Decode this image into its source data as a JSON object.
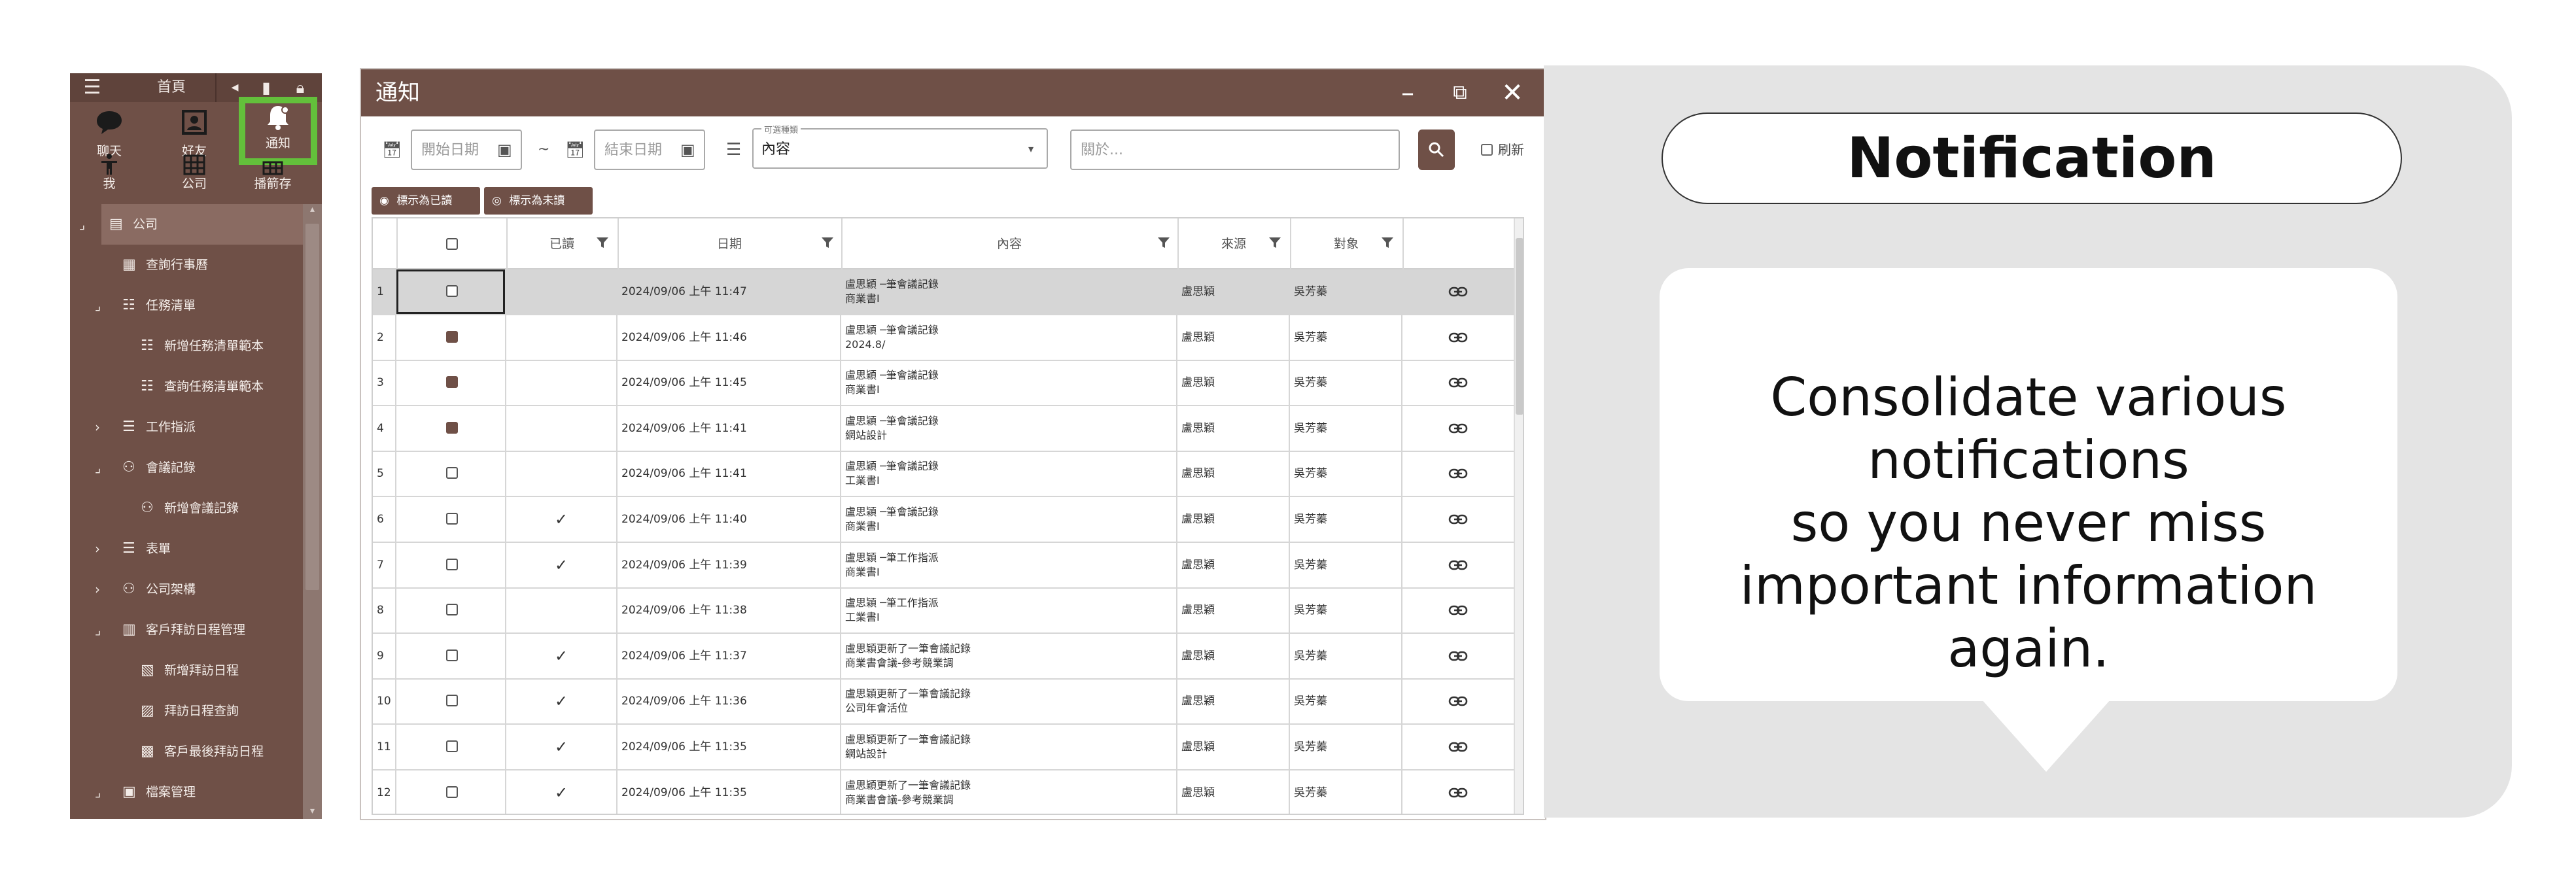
{
  "sidebar": {
    "title": "首頁",
    "tiles": [
      {
        "icon": "chat-bubble-icon",
        "label": "聊天"
      },
      {
        "icon": "friend-card-icon",
        "label": "好友"
      },
      {
        "icon": "bell-icon",
        "label": "通知"
      },
      {
        "icon": "person-icon",
        "label": "我"
      },
      {
        "icon": "building-icon",
        "label": "公司"
      },
      {
        "icon": "grid-icon",
        "label": "播箭存"
      }
    ],
    "tree": [
      {
        "label": "公司",
        "icon": "building-icon",
        "caret": "⌟",
        "indent": 0
      },
      {
        "label": "查詢行事曆",
        "icon": "calendar-icon",
        "caret": "",
        "indent": 1
      },
      {
        "label": "任務清單",
        "icon": "task-list-icon",
        "caret": "⌟",
        "indent": 1
      },
      {
        "label": "新增任務清單範本",
        "icon": "task-list-icon",
        "caret": "",
        "indent": 2
      },
      {
        "label": "查詢任務清單範本",
        "icon": "task-list-icon",
        "caret": "",
        "indent": 2
      },
      {
        "label": "工作指派",
        "icon": "list-icon",
        "caret": "›",
        "indent": 1
      },
      {
        "label": "會議記錄",
        "icon": "people-icon",
        "caret": "⌟",
        "indent": 1
      },
      {
        "label": "新增會議記錄",
        "icon": "people-icon",
        "caret": "",
        "indent": 2
      },
      {
        "label": "表單",
        "icon": "list-icon",
        "caret": "›",
        "indent": 1
      },
      {
        "label": "公司架構",
        "icon": "people-icon",
        "caret": "›",
        "indent": 1
      },
      {
        "label": "客戶拜訪日程管理",
        "icon": "notebook-icon",
        "caret": "⌟",
        "indent": 1
      },
      {
        "label": "新增拜訪日程",
        "icon": "add-doc-icon",
        "caret": "",
        "indent": 2
      },
      {
        "label": "拜訪日程查詢",
        "icon": "search-doc-icon",
        "caret": "",
        "indent": 2
      },
      {
        "label": "客戶最後拜訪日程",
        "icon": "history-doc-icon",
        "caret": "",
        "indent": 2
      },
      {
        "label": "檔案管理",
        "icon": "archive-icon",
        "caret": "⌟",
        "indent": 1
      }
    ]
  },
  "window": {
    "title": "通知",
    "start_date_placeholder": "開始日期",
    "end_date_placeholder": "結束日期",
    "range_sep": "~",
    "kind_legend": "可選種類",
    "kind_value": "內容",
    "keyword_placeholder": "關於...",
    "refresh_label": "刷新",
    "mark_read_label": "標示為已讀",
    "mark_unread_label": "標示為未讀"
  },
  "table": {
    "headers": {
      "read": "已讀",
      "date": "日期",
      "content": "內容",
      "source": "來源",
      "target": "對象"
    },
    "rows": [
      {
        "n": "1",
        "checked": false,
        "read": "",
        "date": "2024/09/06 上午 11:47",
        "c1": "盧思穎        ─筆會議記錄",
        "c2": "商業書I",
        "src": "盧思穎",
        "tgt": "吳芳蓁"
      },
      {
        "n": "2",
        "checked": true,
        "read": "",
        "date": "2024/09/06 上午 11:46",
        "c1": "盧思穎        ─筆會議記錄",
        "c2": "2024.8/",
        "src": "盧思穎",
        "tgt": "吳芳蓁"
      },
      {
        "n": "3",
        "checked": true,
        "read": "",
        "date": "2024/09/06 上午 11:45",
        "c1": "盧思穎        ─筆會議記錄",
        "c2": "商業書I",
        "src": "盧思穎",
        "tgt": "吳芳蓁"
      },
      {
        "n": "4",
        "checked": true,
        "read": "",
        "date": "2024/09/06 上午 11:41",
        "c1": "盧思穎        ─筆會議記錄",
        "c2": "網站設計",
        "src": "盧思穎",
        "tgt": "吳芳蓁"
      },
      {
        "n": "5",
        "checked": false,
        "read": "",
        "date": "2024/09/06 上午 11:41",
        "c1": "盧思穎        ─筆會議記錄",
        "c2": "工業書I",
        "src": "盧思穎",
        "tgt": "吳芳蓁"
      },
      {
        "n": "6",
        "checked": false,
        "read": "✓",
        "date": "2024/09/06 上午 11:40",
        "c1": "盧思穎        ─筆會議記錄",
        "c2": "商業書I",
        "src": "盧思穎",
        "tgt": "吳芳蓁"
      },
      {
        "n": "7",
        "checked": false,
        "read": "✓",
        "date": "2024/09/06 上午 11:39",
        "c1": "盧思穎        ─筆工作指派",
        "c2": "商業書I",
        "src": "盧思穎",
        "tgt": "吳芳蓁"
      },
      {
        "n": "8",
        "checked": false,
        "read": "",
        "date": "2024/09/06 上午 11:38",
        "c1": "盧思穎        ─筆工作指派",
        "c2": "工業書I",
        "src": "盧思穎",
        "tgt": "吳芳蓁"
      },
      {
        "n": "9",
        "checked": false,
        "read": "✓",
        "date": "2024/09/06 上午 11:37",
        "c1": "盧思穎更新了一筆會議記錄",
        "c2": "商業書會議-參考競業調",
        "src": "盧思穎",
        "tgt": "吳芳蓁"
      },
      {
        "n": "10",
        "checked": false,
        "read": "✓",
        "date": "2024/09/06 上午 11:36",
        "c1": "盧思穎更新了一筆會議記錄",
        "c2": "公司年會活位",
        "src": "盧思穎",
        "tgt": "吳芳蓁"
      },
      {
        "n": "11",
        "checked": false,
        "read": "✓",
        "date": "2024/09/06 上午 11:35",
        "c1": "盧思穎更新了一筆會議記錄",
        "c2": "網站設計",
        "src": "盧思穎",
        "tgt": "吳芳蓁"
      },
      {
        "n": "12",
        "checked": false,
        "read": "✓",
        "date": "2024/09/06 上午 11:35",
        "c1": "盧思穎更新了一筆會議記錄",
        "c2": "商業書會議-參考競業調",
        "src": "盧思穎",
        "tgt": "吳芳蓁"
      }
    ]
  },
  "promo": {
    "heading": "Notification",
    "line1": "Consolidate various",
    "line2": "notifications",
    "line3": "so you never miss",
    "line4": "important information again."
  },
  "colors": {
    "brand": "#6f5047",
    "highlight": "#63c03b",
    "panel_bg": "#e4e4e4"
  }
}
